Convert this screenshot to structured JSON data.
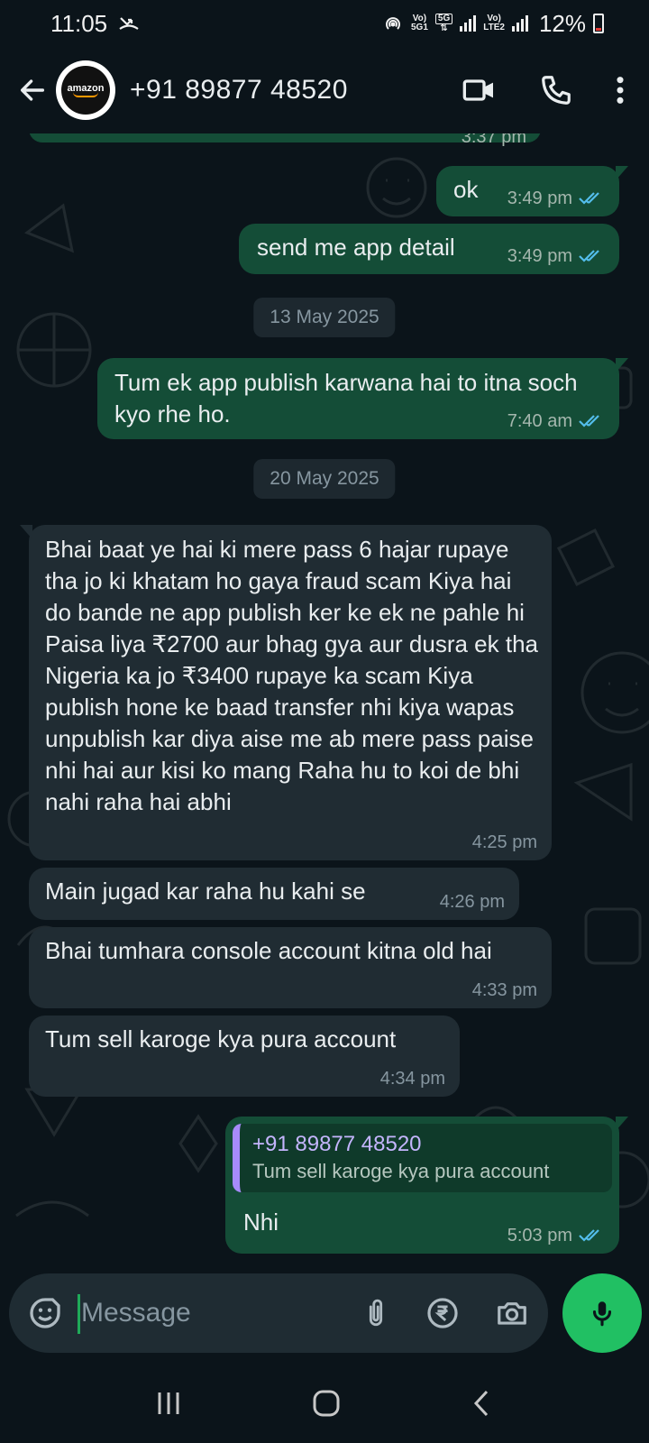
{
  "status_bar": {
    "time": "11:05",
    "net_label_1_top": "Vo)",
    "net_label_1_bottom": "5G1",
    "net_label_2_top": "5G",
    "net_label_3_top": "Vo)",
    "net_label_3_bottom": "LTE2",
    "battery": "12%"
  },
  "header": {
    "avatar_text": "amazon",
    "contact_name": "+91 89877 48520",
    "icons": [
      "back-arrow-icon",
      "video-call-icon",
      "voice-call-icon",
      "more-options-icon"
    ]
  },
  "chat": {
    "partial_top_time": "3:37 pm",
    "messages": [
      {
        "id": "m1",
        "direction": "out",
        "text": "ok",
        "time": "3:49 pm",
        "status": "read"
      },
      {
        "id": "m2",
        "direction": "out",
        "text": "send me app detail",
        "time": "3:49 pm",
        "status": "read"
      },
      {
        "id": "d1",
        "type": "date",
        "text": "13 May 2025"
      },
      {
        "id": "m3",
        "direction": "out",
        "text": "Tum ek app publish karwana hai to itna soch kyo rhe ho.",
        "time": "7:40 am",
        "status": "read"
      },
      {
        "id": "d2",
        "type": "date",
        "text": "20 May 2025"
      },
      {
        "id": "m4",
        "direction": "in",
        "text": "Bhai baat ye hai ki mere pass 6 hajar rupaye tha jo ki khatam ho gaya fraud scam Kiya hai do bande ne app publish ker ke ek ne pahle hi Paisa liya ₹2700 aur bhag gya aur dusra ek tha Nigeria ka jo ₹3400 rupaye ka scam Kiya publish hone ke baad transfer nhi kiya wapas unpublish kar diya aise me ab mere pass paise nhi hai aur kisi ko mang Raha hu to koi de bhi nahi raha hai abhi",
        "time": "4:25 pm"
      },
      {
        "id": "m5",
        "direction": "in",
        "text": "Main jugad kar raha hu kahi se",
        "time": "4:26 pm"
      },
      {
        "id": "m6",
        "direction": "in",
        "text": "Bhai tumhara console account kitna old hai",
        "time": "4:33 pm"
      },
      {
        "id": "m7",
        "direction": "in",
        "text": "Tum sell karoge kya pura account",
        "time": "4:34 pm"
      },
      {
        "id": "m8",
        "direction": "out",
        "quote_name": "+91 89877 48520",
        "quote_text": "Tum sell karoge kya pura account",
        "text": "Nhi",
        "time": "5:03 pm",
        "status": "read"
      }
    ]
  },
  "input": {
    "placeholder": "Message",
    "icons": [
      "emoji-sticker-icon",
      "attach-icon",
      "payment-rupee-icon",
      "camera-icon",
      "mic-icon"
    ]
  },
  "colors": {
    "background": "#0b141a",
    "outgoing_bubble": "#144d37",
    "incoming_bubble": "#202c33",
    "read_tick": "#53bdeb",
    "mic_button": "#21c063"
  }
}
